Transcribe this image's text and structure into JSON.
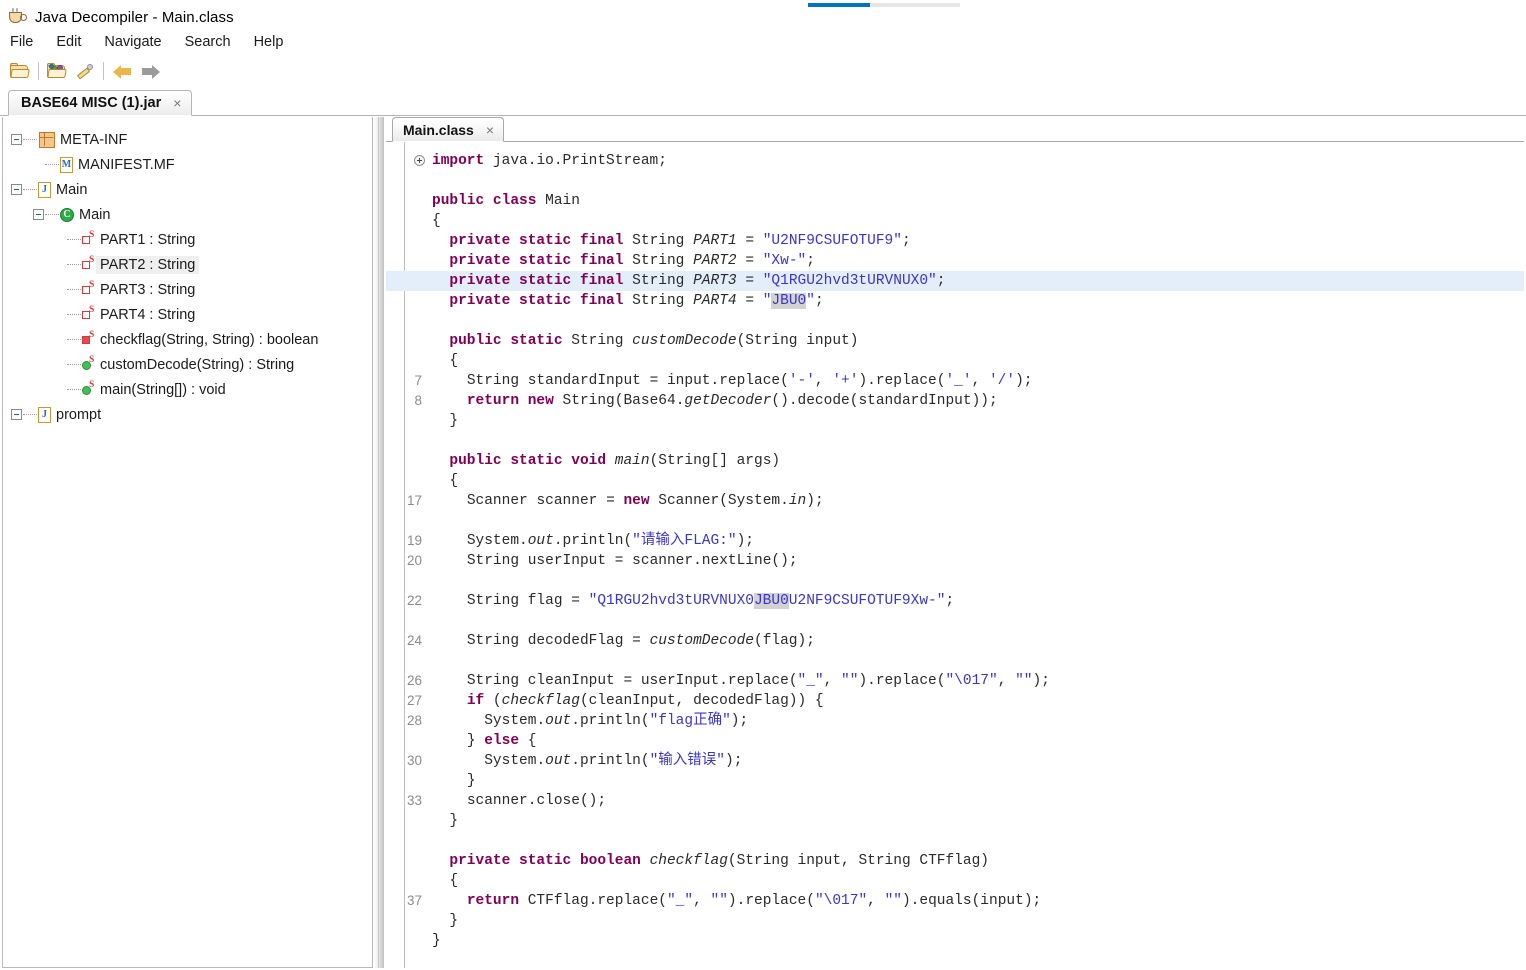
{
  "window": {
    "title": "Java Decompiler - Main.class",
    "app_icon": "coffee-cup-icon"
  },
  "menubar": {
    "items": [
      {
        "label": "File"
      },
      {
        "label": "Edit"
      },
      {
        "label": "Navigate"
      },
      {
        "label": "Search"
      },
      {
        "label": "Help"
      }
    ]
  },
  "toolbar": {
    "buttons": [
      {
        "name": "open-file-icon",
        "title": "Open File"
      },
      {
        "name": "open-type-icon",
        "title": "Open Type"
      },
      {
        "name": "search-pen-icon",
        "title": "Search"
      },
      {
        "name": "back-arrow-icon",
        "title": "Back"
      },
      {
        "name": "forward-arrow-icon",
        "title": "Forward"
      }
    ]
  },
  "progress": {
    "visible": true,
    "fill_color": "#0072c6",
    "track_color": "#e6e6e6"
  },
  "jar_tabs": [
    {
      "label": "BASE64 MISC (1).jar",
      "close": "×",
      "active": true
    }
  ],
  "tree": {
    "nodes": [
      {
        "label": "META-INF",
        "icon": "package-icon",
        "depth": 0,
        "expander": "minus",
        "selected": false
      },
      {
        "label": "MANIFEST.MF",
        "icon": "manifest-icon",
        "depth": 1,
        "expander": "none",
        "selected": false
      },
      {
        "label": "Main",
        "icon": "java-file-icon",
        "depth": 0,
        "expander": "minus",
        "selected": false
      },
      {
        "label": "Main",
        "icon": "class-icon",
        "depth": 1,
        "expander": "minus",
        "selected": false
      },
      {
        "label": "PART1 : String",
        "icon": "field-icon",
        "depth": 2,
        "expander": "none",
        "selected": false
      },
      {
        "label": "PART2 : String",
        "icon": "field-icon",
        "depth": 2,
        "expander": "none",
        "selected": true
      },
      {
        "label": "PART3 : String",
        "icon": "field-icon",
        "depth": 2,
        "expander": "none",
        "selected": false
      },
      {
        "label": "PART4 : String",
        "icon": "field-icon",
        "depth": 2,
        "expander": "none",
        "selected": false
      },
      {
        "label": "checkflag(String, String) : boolean",
        "icon": "field-filled-icon",
        "depth": 2,
        "expander": "none",
        "selected": false
      },
      {
        "label": "customDecode(String) : String",
        "icon": "method-icon",
        "depth": 2,
        "expander": "none",
        "selected": false
      },
      {
        "label": "main(String[]) : void",
        "icon": "method-icon",
        "depth": 2,
        "expander": "none",
        "selected": false
      },
      {
        "label": "prompt",
        "icon": "java-file-icon",
        "depth": 0,
        "expander": "minus",
        "selected": false
      }
    ]
  },
  "editor": {
    "tabs": [
      {
        "label": "Main.class",
        "close": "×",
        "active": true
      }
    ],
    "selection_text": "JBU0",
    "highlight_line_index": 6,
    "lines": [
      {
        "num": "",
        "fold": true,
        "text": "import java.io.PrintStream;"
      },
      {
        "num": "",
        "fold": false,
        "text": ""
      },
      {
        "num": "",
        "fold": false,
        "text": "public class Main"
      },
      {
        "num": "",
        "fold": false,
        "text": "{"
      },
      {
        "num": "",
        "fold": false,
        "text": "  private static final String PART1 = \"U2NF9CSUFOTUF9\";"
      },
      {
        "num": "",
        "fold": false,
        "text": "  private static final String PART2 = \"Xw-\";"
      },
      {
        "num": "",
        "fold": false,
        "text": "  private static final String PART3 = \"Q1RGU2hvd3tURVNUX0\";"
      },
      {
        "num": "",
        "fold": false,
        "text": "  private static final String PART4 = \"JBU0\";"
      },
      {
        "num": "",
        "fold": false,
        "text": ""
      },
      {
        "num": "",
        "fold": false,
        "text": "  public static String customDecode(String input)"
      },
      {
        "num": "",
        "fold": false,
        "text": "  {"
      },
      {
        "num": "7",
        "fold": false,
        "text": "    String standardInput = input.replace('-', '+').replace('_', '/');"
      },
      {
        "num": "8",
        "fold": false,
        "text": "    return new String(Base64.getDecoder().decode(standardInput));"
      },
      {
        "num": "",
        "fold": false,
        "text": "  }"
      },
      {
        "num": "",
        "fold": false,
        "text": ""
      },
      {
        "num": "",
        "fold": false,
        "text": "  public static void main(String[] args)"
      },
      {
        "num": "",
        "fold": false,
        "text": "  {"
      },
      {
        "num": "17",
        "fold": false,
        "text": "    Scanner scanner = new Scanner(System.in);"
      },
      {
        "num": "",
        "fold": false,
        "text": ""
      },
      {
        "num": "19",
        "fold": false,
        "text": "    System.out.println(\"请输入FLAG:\");"
      },
      {
        "num": "20",
        "fold": false,
        "text": "    String userInput = scanner.nextLine();"
      },
      {
        "num": "",
        "fold": false,
        "text": ""
      },
      {
        "num": "22",
        "fold": false,
        "text": "    String flag = \"Q1RGU2hvd3tURVNUX0JBU0U2NF9CSUFOTUF9Xw-\";"
      },
      {
        "num": "",
        "fold": false,
        "text": ""
      },
      {
        "num": "24",
        "fold": false,
        "text": "    String decodedFlag = customDecode(flag);"
      },
      {
        "num": "",
        "fold": false,
        "text": ""
      },
      {
        "num": "26",
        "fold": false,
        "text": "    String cleanInput = userInput.replace(\"_\", \"\").replace(\"\\017\", \"\");"
      },
      {
        "num": "27",
        "fold": false,
        "text": "    if (checkflag(cleanInput, decodedFlag)) {"
      },
      {
        "num": "28",
        "fold": false,
        "text": "      System.out.println(\"flag正确\");"
      },
      {
        "num": "",
        "fold": false,
        "text": "    } else {"
      },
      {
        "num": "30",
        "fold": false,
        "text": "      System.out.println(\"输入错误\");"
      },
      {
        "num": "",
        "fold": false,
        "text": "    }"
      },
      {
        "num": "33",
        "fold": false,
        "text": "    scanner.close();"
      },
      {
        "num": "",
        "fold": false,
        "text": "  }"
      },
      {
        "num": "",
        "fold": false,
        "text": ""
      },
      {
        "num": "",
        "fold": false,
        "text": "  private static boolean checkflag(String input, String CTFflag)"
      },
      {
        "num": "",
        "fold": false,
        "text": "  {"
      },
      {
        "num": "37",
        "fold": false,
        "text": "    return CTFflag.replace(\"_\", \"\").replace(\"\\017\", \"\").equals(input);"
      },
      {
        "num": "",
        "fold": false,
        "text": "  }"
      },
      {
        "num": "",
        "fold": false,
        "text": "}"
      }
    ]
  },
  "colors": {
    "keyword": "#7f0055",
    "string": "#3a36c8",
    "line_number": "#8b8b8b",
    "highlight_row": "#e4eefb",
    "selection": "#d2d2d2"
  }
}
